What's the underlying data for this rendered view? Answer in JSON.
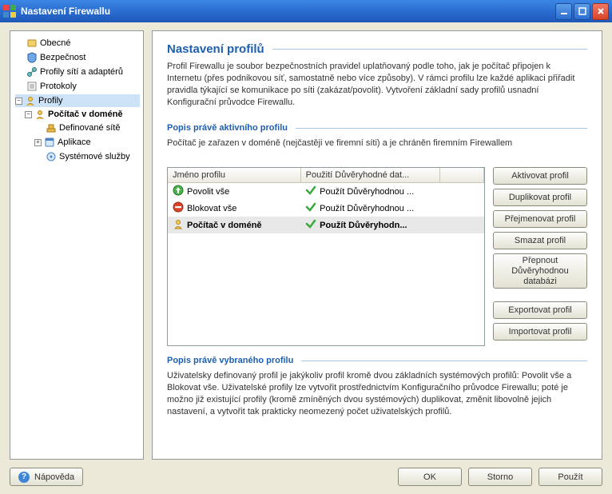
{
  "window": {
    "title": "Nastavení Firewallu"
  },
  "tree": {
    "items": {
      "obecne": "Obecné",
      "bezpecnost": "Bezpečnost",
      "profily_siti": "Profily sítí a adaptérů",
      "protokoly": "Protokoly",
      "profily": "Profily",
      "pocitac_v_domene": "Počítač v doméně",
      "definovane_site": "Definované sítě",
      "aplikace": "Aplikace",
      "systemove_sluzby": "Systémové služby"
    }
  },
  "content": {
    "heading": "Nastavení profilů",
    "intro": "Profil Firewallu je soubor bezpečnostních pravidel uplatňovaný podle toho, jak je počítač připojen k Internetu (přes podnikovou síť, samostatně nebo více způsoby). V rámci profilu lze každé aplikaci přiřadit pravidla týkající se komunikace po síti (zakázat/povolit). Vytvoření základní sady profilů usnadní Konfigurační průvodce Firewallu.",
    "active_heading": "Popis právě aktivního profilu",
    "active_desc": "Počítač je zařazen v doméně (nejčastěji ve firemní síti) a je chráněn firemním Firewallem",
    "selected_heading": "Popis právě vybraného profilu",
    "selected_desc": "Uživatelsky definovaný profil je jakýkoliv profil kromě dvou základních systémových profilů: Povolit vše a Blokovat vše. Uživatelské profily lze vytvořit prostřednictvím Konfiguračního průvodce Firewallu; poté je možno již existující profily (kromě zmíněných dvou systémových) duplikovat, změnit libovolně jejich nastavení, a vytvořit tak prakticky neomezený počet uživatelských profilů."
  },
  "table": {
    "col_name": "Jméno profilu",
    "col_db": "Použití Důvěryhodné dat...",
    "rows": [
      {
        "name": "Povolit vše",
        "db": "Použít Důvěryhodnou ...",
        "icon": "allow"
      },
      {
        "name": "Blokovat vše",
        "db": "Použít Důvěryhodnou ...",
        "icon": "block"
      },
      {
        "name": "Počítač v doméně",
        "db": "Použít Důvěryhodn...",
        "icon": "domain",
        "selected": true
      }
    ]
  },
  "sidebuttons": {
    "activate": "Aktivovat profil",
    "duplicate": "Duplikovat profil",
    "rename": "Přejmenovat profil",
    "delete": "Smazat profil",
    "switchdb": "Přepnout Důvěryhodnou databázi",
    "export": "Exportovat profil",
    "import": "Importovat profil"
  },
  "bottom": {
    "help": "Nápověda",
    "ok": "OK",
    "cancel": "Storno",
    "apply": "Použít"
  }
}
